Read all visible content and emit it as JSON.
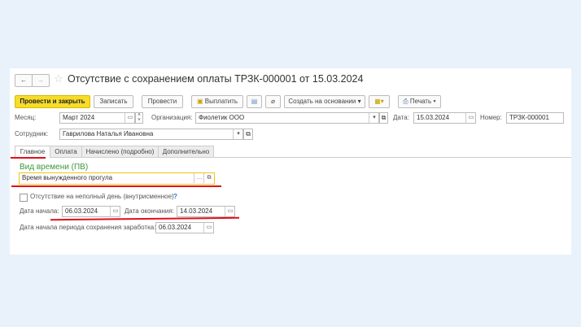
{
  "title": "Отсутствие с сохранением оплаты ТРЗК-000001 от 15.03.2024",
  "toolbar": {
    "post_close": "Провести и закрыть",
    "save": "Записать",
    "post": "Провести",
    "pay": "Выплатить",
    "create_based": "Создать на основании",
    "print": "Печать"
  },
  "header": {
    "month_label": "Месяц:",
    "month": "Март 2024",
    "org_label": "Организация:",
    "org": "Фиолетик ООО",
    "date_label": "Дата:",
    "date": "15.03.2024",
    "number_label": "Номер:",
    "number": "ТРЗК-000001",
    "employee_label": "Сотрудник:",
    "employee": "Гаврилова Наталья Ивановна"
  },
  "tabs": [
    {
      "label": "Главное",
      "active": true
    },
    {
      "label": "Оплата"
    },
    {
      "label": "Начислено (подробно)"
    },
    {
      "label": "Дополнительно"
    }
  ],
  "main": {
    "time_type_label": "Вид времени (ПВ)",
    "time_type": "Время вынужденного прогула",
    "partial_day_label": "Отсутствие на неполный день (внутрисменное)",
    "partial_day_checked": false,
    "help": "?",
    "start_label": "Дата начала:",
    "start": "06.03.2024",
    "end_label": "Дата окончания:",
    "end": "14.03.2024",
    "period_start_label": "Дата начала периода сохранения заработка:",
    "period_start": "06.03.2024"
  },
  "colors": {
    "primary": "#f7dc2a",
    "highlight": "#e0101a",
    "group_title": "#3a9a3a"
  }
}
